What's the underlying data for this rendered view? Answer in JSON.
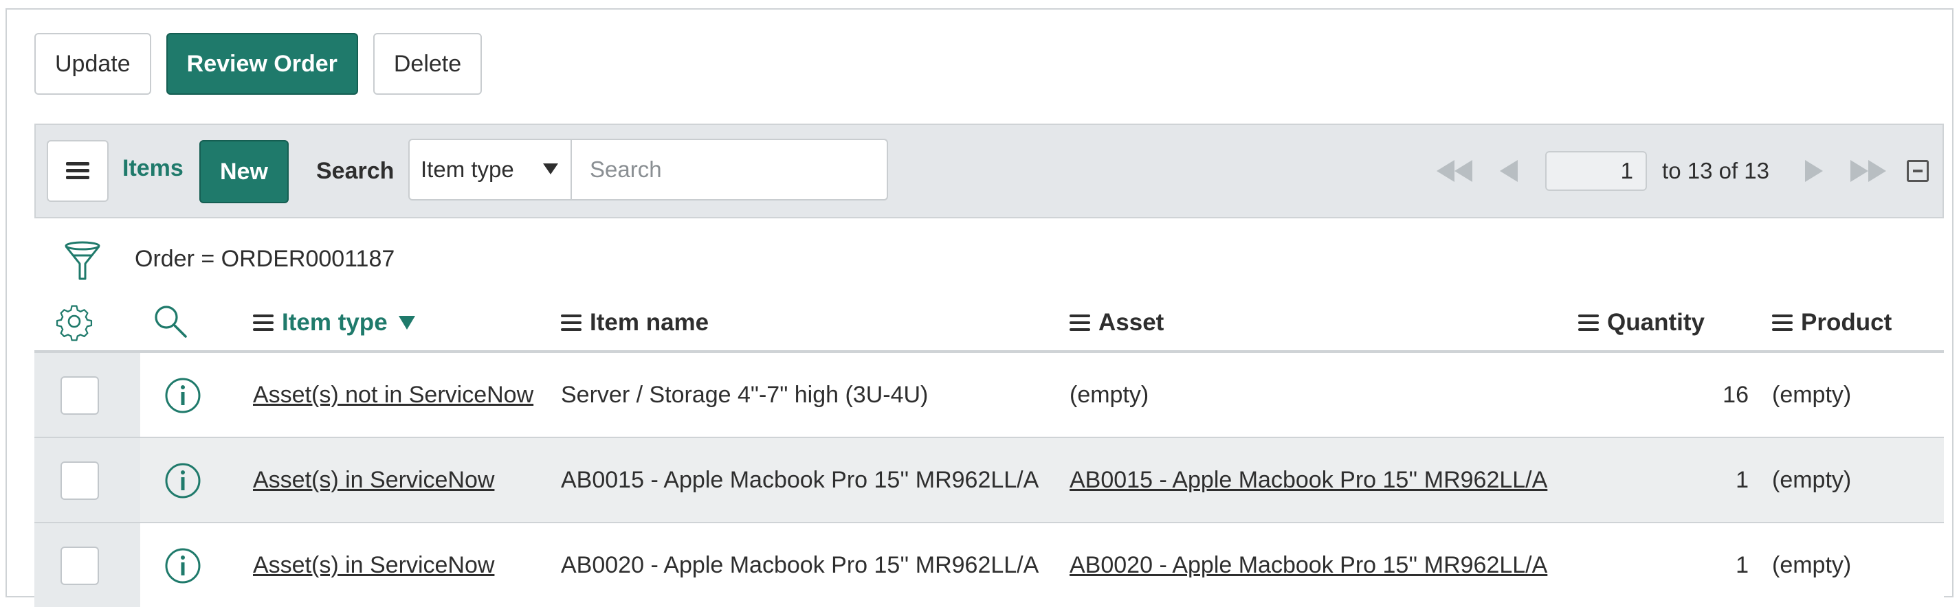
{
  "actions": {
    "update_label": "Update",
    "review_order_label": "Review Order",
    "delete_label": "Delete"
  },
  "list_header": {
    "title": "Items",
    "new_label": "New",
    "search_label": "Search",
    "search_field_selected": "Item type",
    "search_placeholder": "Search",
    "page_input_value": "1",
    "range_text": "to 13 of 13"
  },
  "filter": {
    "text": "Order = ORDER0001187"
  },
  "columns": {
    "item_type": "Item type",
    "item_name": "Item name",
    "asset": "Asset",
    "quantity": "Quantity",
    "product": "Product"
  },
  "rows": [
    {
      "item_type": "Asset(s) not in ServiceNow",
      "item_name": "Server / Storage 4\"-7\" high (3U-4U)",
      "asset": "(empty)",
      "quantity": "16",
      "product": "(empty)"
    },
    {
      "item_type": "Asset(s) in ServiceNow",
      "item_name": "AB0015 - Apple Macbook Pro 15'' MR962LL/A",
      "asset": "AB0015 - Apple Macbook Pro 15'' MR962LL/A",
      "quantity": "1",
      "product": "(empty)"
    },
    {
      "item_type": "Asset(s) in ServiceNow",
      "item_name": "AB0020 - Apple Macbook Pro 15'' MR962LL/A",
      "asset": "AB0020 - Apple Macbook Pro 15'' MR962LL/A",
      "quantity": "1",
      "product": "(empty)"
    }
  ],
  "colors": {
    "accent": "#1f7a6b",
    "header_bar": "#e4e7ea",
    "alt_row": "#eceeef"
  }
}
